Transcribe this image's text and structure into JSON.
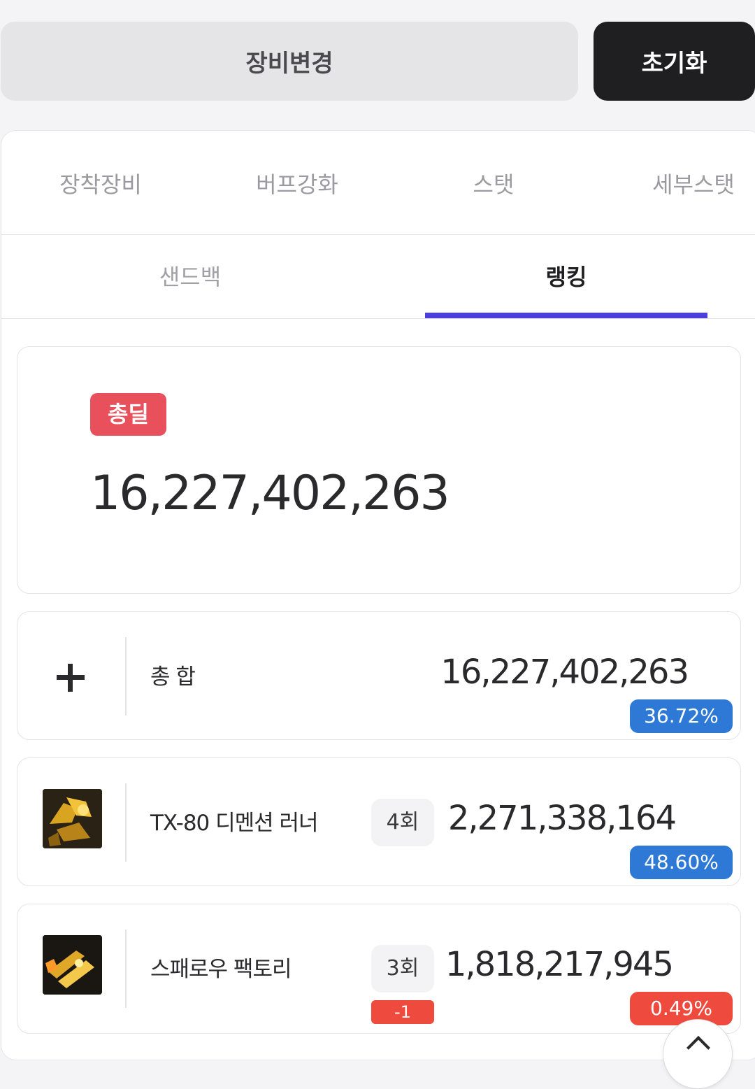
{
  "toolbar": {
    "change_gear_label": "장비변경",
    "reset_label": "초기화"
  },
  "tabs_primary": [
    {
      "label": "장착장비"
    },
    {
      "label": "버프강화"
    },
    {
      "label": "스탯"
    },
    {
      "label": "세부스탯"
    }
  ],
  "tabs_secondary": [
    {
      "label": "샌드백",
      "active": false
    },
    {
      "label": "랭킹",
      "active": true
    }
  ],
  "total": {
    "badge": "총딜",
    "value": "16,227,402,263"
  },
  "rows": [
    {
      "icon": "plus-icon",
      "name": "총 합",
      "value": "16,227,402,263",
      "percent": "36.72%",
      "percent_color": "#2f79d6"
    },
    {
      "icon": "tx80-dimension-runner-icon",
      "name": "TX-80 디멘션 러너",
      "count": "4회",
      "value": "2,271,338,164",
      "percent": "48.60%",
      "percent_color": "#2f79d6"
    },
    {
      "icon": "sparrow-factory-icon",
      "name": "스패로우 팩토리",
      "count": "3회",
      "delta": "-1",
      "value": "1,818,217,945",
      "percent": "0.49%",
      "percent_color": "#ef4a3e"
    }
  ],
  "colors": {
    "accent": "#4b3fe0",
    "badge_red": "#e8505b",
    "pct_blue": "#2f79d6",
    "pct_red": "#ef4a3e"
  }
}
